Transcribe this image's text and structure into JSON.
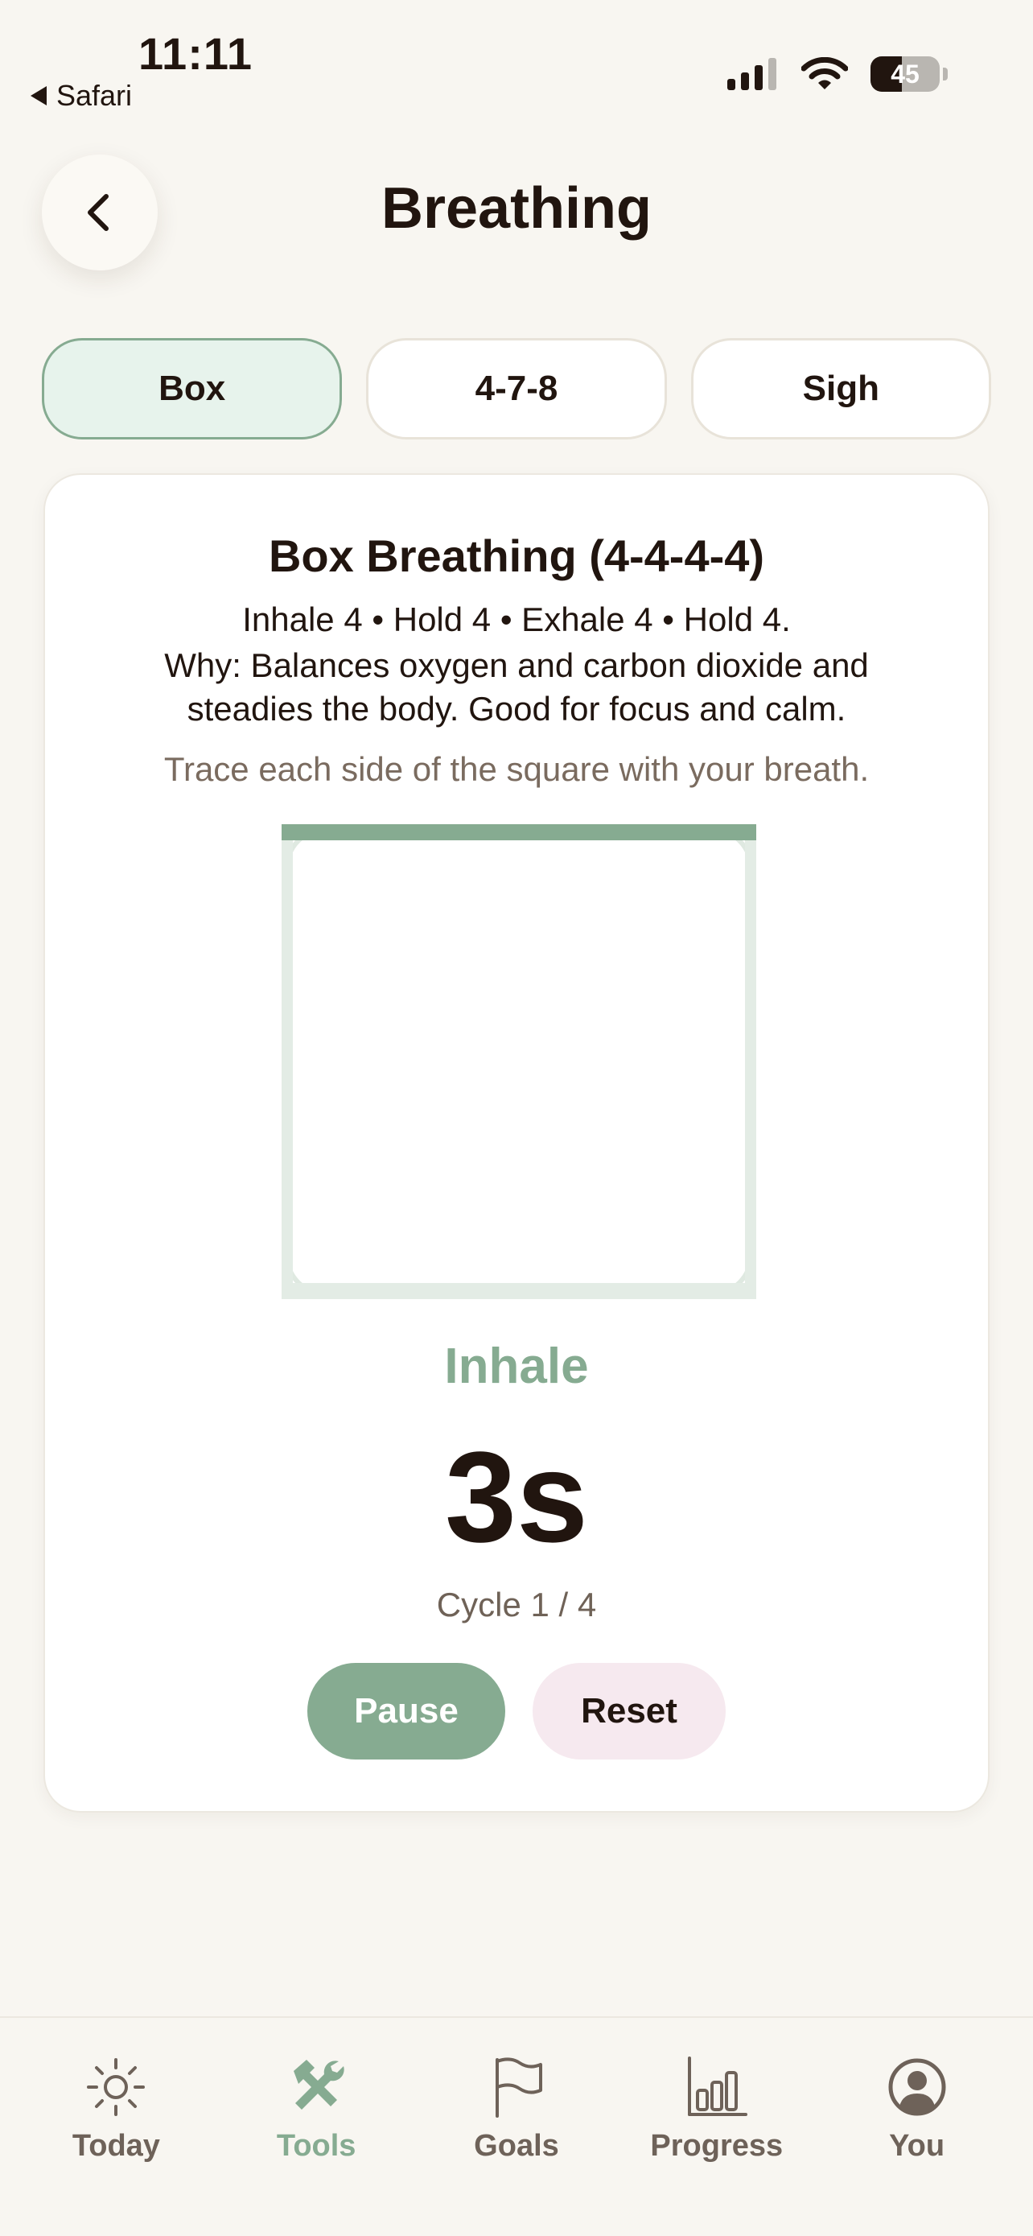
{
  "status": {
    "time": "11:11",
    "back_app": "Safari",
    "battery": "45",
    "battery_level": 0.45
  },
  "header": {
    "title": "Breathing"
  },
  "tabs": [
    {
      "label": "Box",
      "active": true
    },
    {
      "label": "4-7-8",
      "active": false
    },
    {
      "label": "Sigh",
      "active": false
    }
  ],
  "card": {
    "title": "Box Breathing (4-4-4-4)",
    "steps": "Inhale 4 • Hold 4 • Exhale 4 • Hold 4.",
    "why": "Why: Balances oxygen and carbon dioxide and steadies the body. Good for focus and calm.",
    "hint": "Trace each side of the square with your breath.",
    "phase": "Inhale",
    "count": "3s",
    "cycle": "Cycle 1 / 4",
    "pause_label": "Pause",
    "reset_label": "Reset"
  },
  "nav": [
    {
      "label": "Today",
      "icon": "sun-icon",
      "active": false
    },
    {
      "label": "Tools",
      "icon": "tools-icon",
      "active": true
    },
    {
      "label": "Goals",
      "icon": "flag-icon",
      "active": false
    },
    {
      "label": "Progress",
      "icon": "bar-chart-icon",
      "active": false
    },
    {
      "label": "You",
      "icon": "user-circle-icon",
      "active": false
    }
  ],
  "colors": {
    "accent": "#86ab91",
    "background": "#f8f6f1",
    "text": "#21150f",
    "muted": "#7a6b5f",
    "reset_bg": "#f6e9ef",
    "active_tab_bg": "#e7f3ec"
  }
}
